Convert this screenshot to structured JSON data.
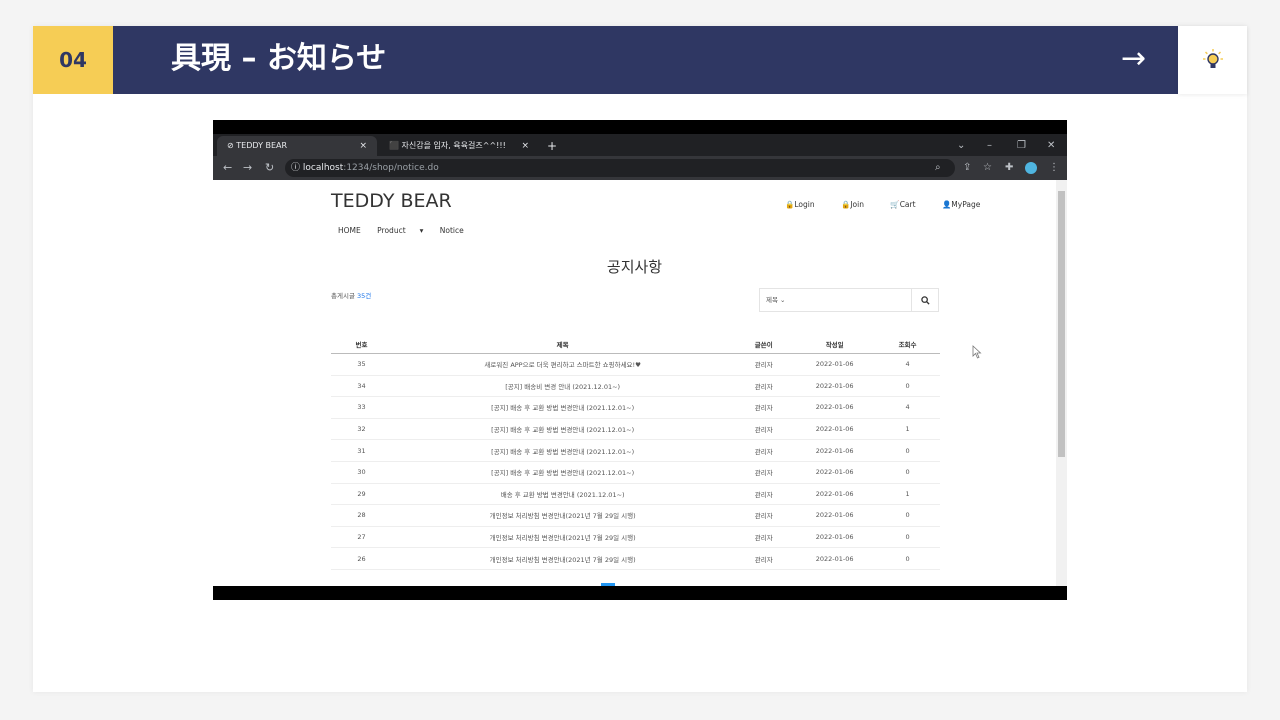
{
  "slide": {
    "number": "04",
    "title": "具現 – お知らせ",
    "arrow": "→",
    "accent_color": "#f6cd55",
    "header_color": "#2f3763",
    "bulb_icon": "lightbulb-icon"
  },
  "browser": {
    "tabs": [
      {
        "label": "TEDDY BEAR",
        "close": "×"
      },
      {
        "label": "자신감을 입자, 육육걸즈^^!!!",
        "close": "×"
      }
    ],
    "new_tab": "+",
    "url_host": "localhost",
    "url_path": ":1234/shop/notice.do"
  },
  "site": {
    "brand": "TEDDY BEAR",
    "top_links": [
      "Login",
      "Join",
      "Cart",
      "MyPage"
    ],
    "menu": [
      "HOME",
      "Product",
      "Notice"
    ],
    "page_title": "공지사항",
    "count_prefix": "총게시글 ",
    "count_value": "35건",
    "search_select": "제목",
    "columns": [
      "번호",
      "제목",
      "글쓴이",
      "작성일",
      "조회수"
    ],
    "rows": [
      {
        "no": "35",
        "title": "새로워진 APP으로 더욱 편리하고 스마트한 쇼핑하세요!♥",
        "writer": "관리자",
        "date": "2022-01-06",
        "views": "4"
      },
      {
        "no": "34",
        "title": "[공지] 배송비 변경 안내 (2021.12.01~)",
        "writer": "관리자",
        "date": "2022-01-06",
        "views": "0"
      },
      {
        "no": "33",
        "title": "[공지] 배송 후 교환 방법 변경안내 (2021.12.01~)",
        "writer": "관리자",
        "date": "2022-01-06",
        "views": "4"
      },
      {
        "no": "32",
        "title": "[공지] 배송 후 교환 방법 변경안내 (2021.12.01~)",
        "writer": "관리자",
        "date": "2022-01-06",
        "views": "1"
      },
      {
        "no": "31",
        "title": "[공지] 배송 후 교환 방법 변경안내 (2021.12.01~)",
        "writer": "관리자",
        "date": "2022-01-06",
        "views": "0"
      },
      {
        "no": "30",
        "title": "[공지] 배송 후 교환 방법 변경안내 (2021.12.01~)",
        "writer": "관리자",
        "date": "2022-01-06",
        "views": "0"
      },
      {
        "no": "29",
        "title": "배송 후 교환 방법 변경안내 (2021.12.01~)",
        "writer": "관리자",
        "date": "2022-01-06",
        "views": "1"
      },
      {
        "no": "28",
        "title": "개인정보 처리방침 변경안내(2021년 7월 29일 시행)",
        "writer": "관리자",
        "date": "2022-01-06",
        "views": "0"
      },
      {
        "no": "27",
        "title": "개인정보 처리방침 변경안내(2021년 7월 29일 시행)",
        "writer": "관리자",
        "date": "2022-01-06",
        "views": "0"
      },
      {
        "no": "26",
        "title": "개인정보 처리방침 변경안내(2021년 7월 29일 시행)",
        "writer": "관리자",
        "date": "2022-01-06",
        "views": "0"
      }
    ]
  }
}
